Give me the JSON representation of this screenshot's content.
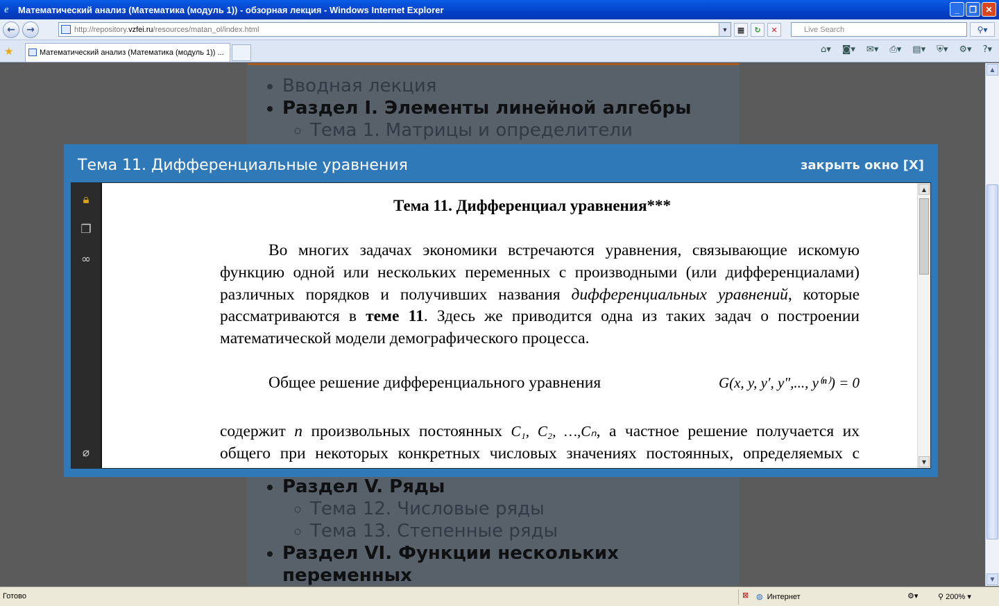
{
  "window": {
    "title": "Математический анализ (Математика (модуль 1)) - обзорная лекция - Windows Internet Explorer",
    "address_prefix": "http://repository.",
    "address_domain": "vzfei.ru",
    "address_suffix": "/resources/matan_ol/index.html",
    "search_placeholder": "Live Search",
    "tab_title": "Математический анализ (Математика (модуль 1)) ...",
    "status_text": "Готово",
    "zone_text": "Интернет",
    "zoom_text": "200%"
  },
  "background_page": {
    "top_items": [
      {
        "text": "Вводная лекция",
        "bold": false
      },
      {
        "text": "Раздел I. Элементы линейной алгебры",
        "bold": true
      }
    ],
    "top_sub": [
      "Тема 1. Матрицы и определители"
    ],
    "bottom_items": [
      {
        "text": "Раздел V. Ряды",
        "bold": true
      }
    ],
    "bottom_sub": [
      "Тема 12. Числовые ряды",
      "Тема 13. Степенные ряды"
    ],
    "last_item": "Раздел VI. Функции нескольких переменных"
  },
  "modal": {
    "title": "Тема 11. Дифференциальные уравнения",
    "close_label": "закрыть окно [X]"
  },
  "document": {
    "heading": "Тема 11. Дифференциал уравнения***",
    "p1_a": "Во многих задачах экономики встречаются уравнения, связывающие искомую функцию одной или нескольких  переменных с производными (или дифференциалами) различных порядков и получивших названия ",
    "p1_italic": "дифференциальных уравнений",
    "p1_b": ", которые рассматриваются в ",
    "p1_bold": "теме 11",
    "p1_c": ". Здесь же приводится одна из таких задач о построении математической модели демографического процесса.",
    "p2_a": "Общее решение дифференциального уравнения ",
    "p2_formula": "G(x, y, y′, y″,..., y⁽ⁿ⁾) = 0",
    "p2_b": "содержит ",
    "p2_n": "n",
    "p2_c": " произвольных постоянных ",
    "p2_consts": "C₁, C₂, …,Cₙ",
    "p2_d": ", а частное решение получается их общего при некоторых конкретных числовых значениях постоянных, определяемых с помощью начальных условий."
  }
}
